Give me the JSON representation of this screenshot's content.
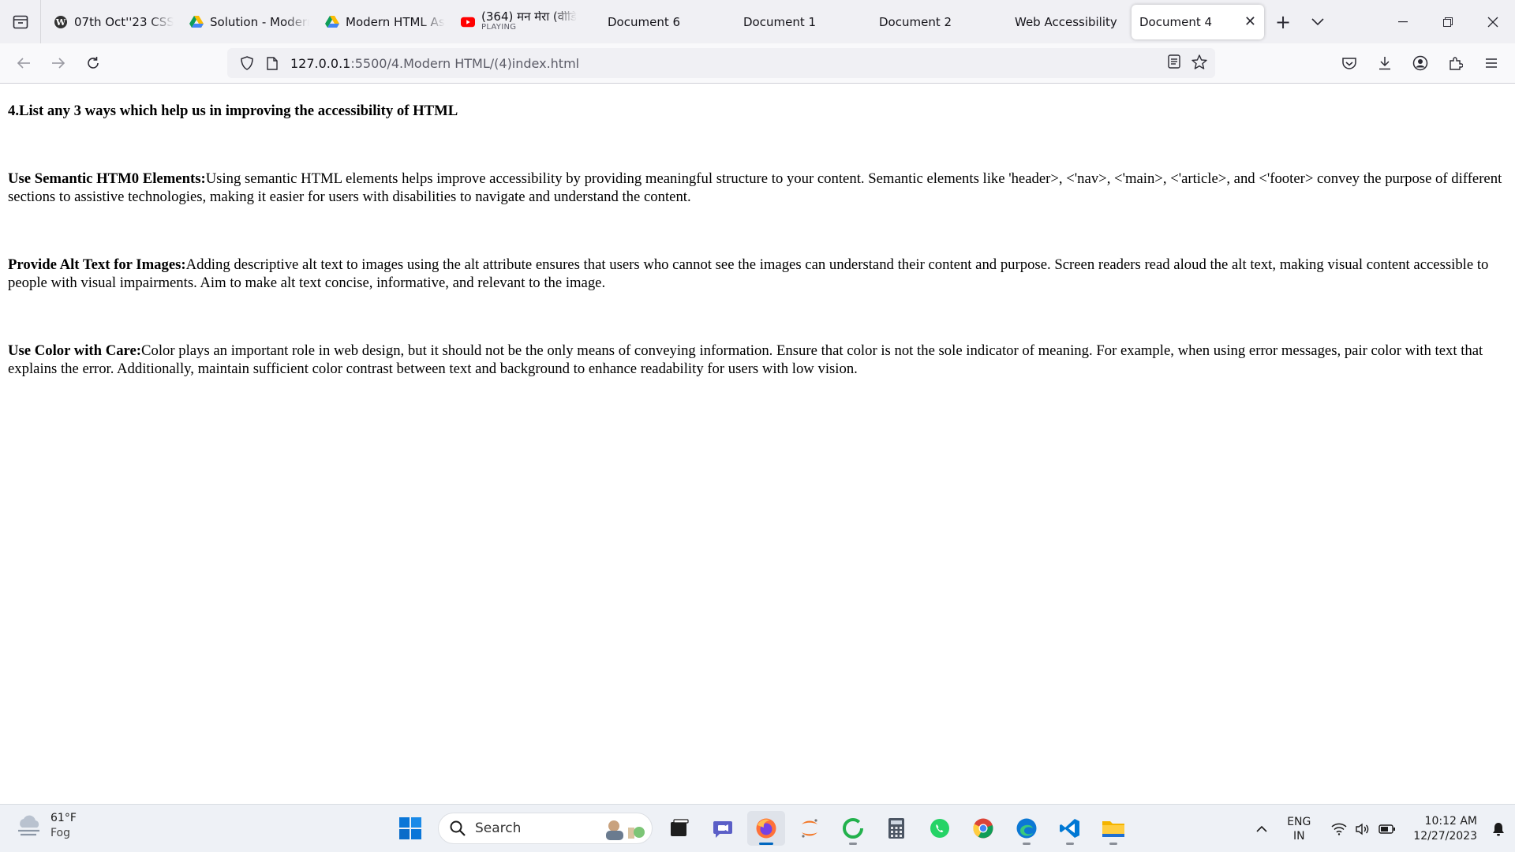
{
  "browser": {
    "tabs": [
      {
        "label": "07th Oct''23 CSS g",
        "icon": "wordpress-icon"
      },
      {
        "label": "Solution - Modern",
        "icon": "google-drive-icon"
      },
      {
        "label": "Modern HTML As",
        "icon": "google-drive-icon"
      },
      {
        "label": "(364) मन मेरा (वीडि",
        "sublabel": "PLAYING",
        "icon": "youtube-icon"
      },
      {
        "label": "Document 6"
      },
      {
        "label": "Document 1"
      },
      {
        "label": "Document 2"
      },
      {
        "label": "Web Accessibility"
      },
      {
        "label": "Document 4",
        "active": true
      }
    ],
    "url": {
      "host": "127.0.0.1",
      "path": ":5500/4.Modern HTML/(4)index.html"
    }
  },
  "page": {
    "heading": "4.List any 3 ways which help us in improving the accessibility of HTML",
    "items": [
      {
        "term": "Use Semantic HTM0 Elements:",
        "text": "Using semantic HTML elements helps improve accessibility by providing meaningful structure to your content. Semantic elements like 'header>, <'nav>, <'main>, <'article>, and <'footer> convey the purpose of different sections to assistive technologies, making it easier for users with disabilities to navigate and understand the content."
      },
      {
        "term": "Provide Alt Text for Images:",
        "text": "Adding descriptive alt text to images using the alt attribute ensures that users who cannot see the images can understand their content and purpose. Screen readers read aloud the alt text, making visual content accessible to people with visual impairments. Aim to make alt text concise, informative, and relevant to the image."
      },
      {
        "term": "Use Color with Care:",
        "text": "Color plays an important role in web design, but it should not be the only means of conveying information. Ensure that color is not the sole indicator of meaning. For example, when using error messages, pair color with text that explains the error. Additionally, maintain sufficient color contrast between text and background to enhance readability for users with low vision."
      }
    ]
  },
  "taskbar": {
    "weather": {
      "temp": "61°F",
      "condition": "Fog"
    },
    "search_label": "Search",
    "lang": {
      "line1": "ENG",
      "line2": "IN"
    },
    "clock": {
      "time": "10:12 AM",
      "date": "12/27/2023"
    }
  },
  "colors": {
    "accent": "#0067c0",
    "tab_strip": "#f0f0f4",
    "youtube_red": "#ff0000"
  }
}
